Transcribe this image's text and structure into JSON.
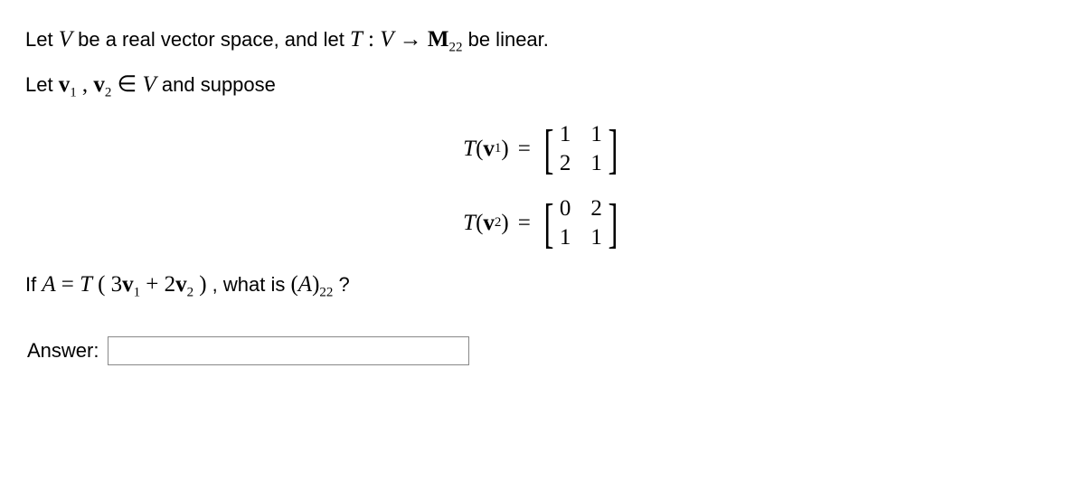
{
  "intro": {
    "let_prefix": "Let ",
    "V": "V",
    "be_real_vs": " be a real vector space, and let ",
    "T": "T",
    "colon": " : ",
    "arrow": " → ",
    "M": "M",
    "M_sub": "22",
    "be_linear": " be linear."
  },
  "line2": {
    "let_prefix": "Let ",
    "v": "v",
    "sub1": "1",
    "comma": ", ",
    "sub2": "2",
    "inV": " ∈ ",
    "V": "V",
    "and_suppose": " and suppose"
  },
  "eq1": {
    "T": "T",
    "lparen": "(",
    "v": "v",
    "sub": "1",
    "rparen": ")",
    "equals": "=",
    "m11": "1",
    "m12": "1",
    "m21": "2",
    "m22": "1"
  },
  "eq2": {
    "T": "T",
    "lparen": "(",
    "v": "v",
    "sub": "2",
    "rparen": ")",
    "equals": "=",
    "m11": "0",
    "m12": "2",
    "m21": "1",
    "m22": "1"
  },
  "question": {
    "if_prefix": "If ",
    "A": "A",
    "equals": " = ",
    "T": "T",
    "lparen": "(",
    "coef1": "3",
    "v": "v",
    "sub1": "1",
    "plus": " + ",
    "coef2": "2",
    "sub2": "2",
    "rparen": ")",
    "what_is": ", what is ",
    "A2": "A",
    "paren_open": "(",
    "paren_close": ")",
    "sub22": "22",
    "qmark": "?"
  },
  "answer": {
    "label": "Answer:",
    "value": "",
    "placeholder": ""
  }
}
